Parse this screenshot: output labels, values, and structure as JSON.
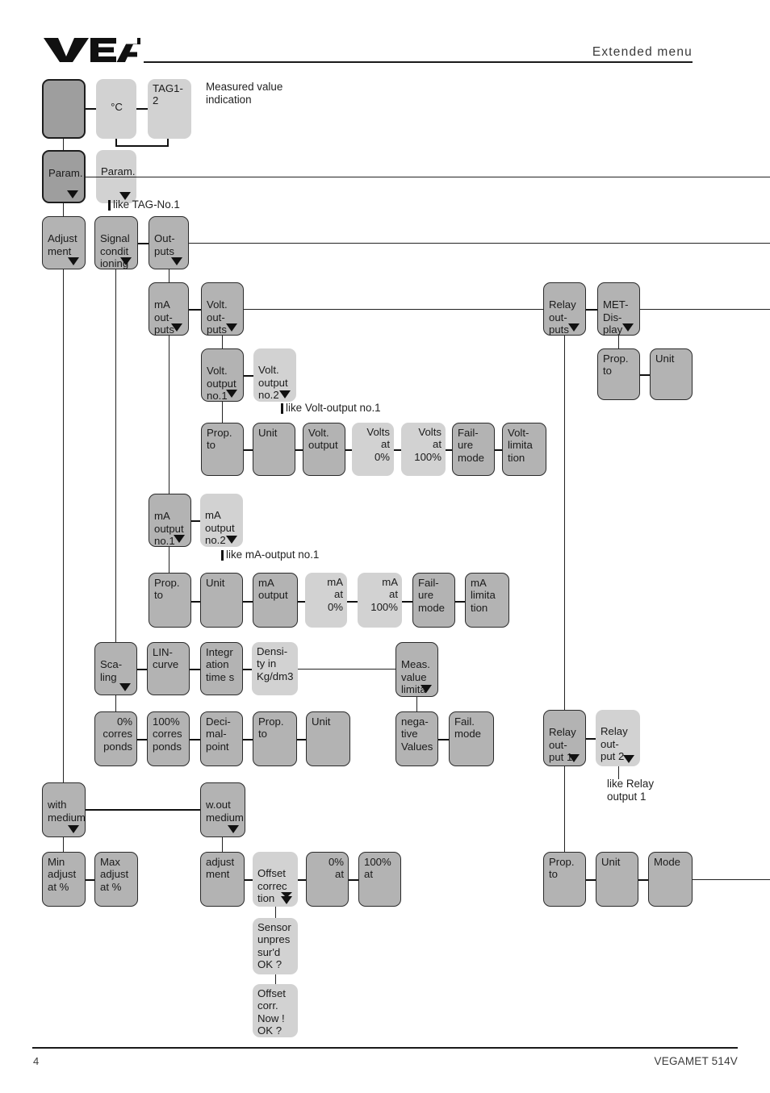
{
  "header": {
    "logo_text": "VEGA",
    "title": "Extended menu"
  },
  "footer": {
    "page_number": "4",
    "product": "VEGAMET 514V"
  },
  "colors": {
    "box_dark": "#9e9e9e",
    "box_mid": "#b3b3b3",
    "box_light": "#d2d2d2",
    "line": "#111111",
    "text": "#1b1b1b"
  },
  "annotations": {
    "measured_value": "Measured value\nindication",
    "like_tag_no1": "like TAG-No.1",
    "like_volt_output_no1": "like Volt-output no.1",
    "like_ma_output_no1": "like mA-output no.1",
    "like_relay_output_1": "like Relay\noutput 1"
  },
  "boxes": {
    "blank_top": "",
    "degc": "°C",
    "tag12": "TAG1-2",
    "param_1": "Param.",
    "param_2": "Param.",
    "adjustment": "Adjust\nment",
    "signal_conditioning": "Signal\ncondit\nioning",
    "outputs": "Out-\nputs",
    "ma_outputs": "mA\nout-\nputs",
    "volt_outputs": "Volt.\nout-\nputs",
    "relay_outputs": "Relay\nout-\nputs",
    "met_display": "MET-\nDis-\nplay",
    "volt_output_no1": "Volt.\noutput\nno.1",
    "volt_output_no2": "Volt.\noutput\nno.2",
    "met_prop_to": "Prop.\nto",
    "met_unit": "Unit",
    "volt_prop_to": "Prop.\nto",
    "volt_unit": "Unit",
    "volt_output": "Volt.\noutput",
    "volts_at_0": "Volts\nat\n0%",
    "volts_at_100": "Volts\nat\n100%",
    "volt_failure_mode": "Fail-\nure\nmode",
    "volt_limitation": "Volt-\nlimita\ntion",
    "ma_output_no1": "mA\noutput\nno.1",
    "ma_output_no2": "mA\noutput\nno.2",
    "ma_prop_to": "Prop.\nto",
    "ma_unit": "Unit",
    "ma_output": "mA\noutput",
    "ma_at_0": "mA\nat\n0%",
    "ma_at_100": "mA\nat\n100%",
    "ma_failure_mode": "Fail-\nure\nmode",
    "ma_limitation": "mA\nlimita\ntion",
    "scaling": "Sca-\nling",
    "lin_curve": "LIN-\ncurve",
    "integration_time": "Integr\nation\ntime s",
    "density": "Densi-\nty in\nKg/dm3",
    "meas_value_limitation": "Meas.\nvalue\nlimita\ntion",
    "corresponds_0": "0%\ncorres\nponds",
    "corresponds_100": "100%\ncorres\nponds",
    "decimal_point": "Deci-\nmal-\npoint",
    "scal_prop_to": "Prop.\nto",
    "scal_unit": "Unit",
    "negative_values": "nega-\ntive\nValues",
    "fail_mode": "Fail.\nmode",
    "relay_output_1": "Relay\nout-\nput 1",
    "relay_output_2": "Relay\nout-\nput 2",
    "with_medium": "with\nmedium",
    "without_medium": "w.out\nmedium",
    "min_adjust": "Min\nadjust\nat  %",
    "max_adjust": "Max\nadjust\nat  %",
    "adjust_ment": "adjust\nment",
    "offset_correction": "Offset\ncorrec\ntion",
    "at_0": "0%\nat",
    "at_100": "100%\nat",
    "sensor_unpressured": "Sensor\nunpres\nsur'd\nOK ?",
    "offset_corr_now": "Offset\ncorr.\nNow !\n OK ?",
    "relay_prop_to": "Prop.\nto",
    "relay_unit": "Unit",
    "relay_mode": "Mode"
  }
}
